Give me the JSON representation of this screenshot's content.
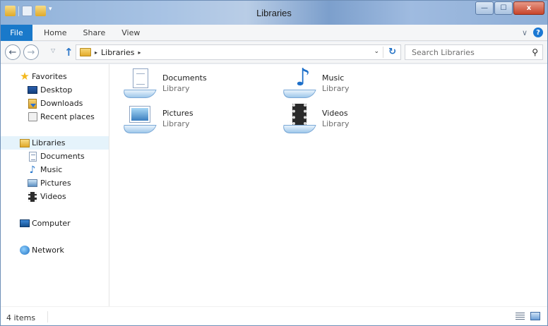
{
  "window": {
    "title": "Libraries",
    "controls": {
      "minimize": "—",
      "maximize": "☐",
      "close": "x"
    }
  },
  "ribbon": {
    "file_label": "File",
    "tabs": [
      "Home",
      "Share",
      "View"
    ],
    "expand_icon": "chevron-down-icon",
    "help_label": "?"
  },
  "nav": {
    "back_glyph": "←",
    "forward_glyph": "→",
    "recent_glyph": "▽",
    "up_glyph": "↑"
  },
  "address": {
    "arrow": "▸",
    "crumbs": [
      "Libraries"
    ],
    "dropdown_glyph": "⌄",
    "refresh_glyph": "↻"
  },
  "search": {
    "placeholder": "Search Libraries",
    "icon": "search-icon"
  },
  "sidebar": {
    "favorites": {
      "label": "Favorites",
      "items": [
        {
          "label": "Desktop",
          "icon": "desktop-icon"
        },
        {
          "label": "Downloads",
          "icon": "downloads-icon"
        },
        {
          "label": "Recent places",
          "icon": "recent-places-icon"
        }
      ]
    },
    "libraries": {
      "label": "Libraries",
      "selected": true,
      "items": [
        {
          "label": "Documents",
          "icon": "documents-icon"
        },
        {
          "label": "Music",
          "icon": "music-icon"
        },
        {
          "label": "Pictures",
          "icon": "pictures-icon"
        },
        {
          "label": "Videos",
          "icon": "videos-icon"
        }
      ]
    },
    "computer": {
      "label": "Computer",
      "icon": "computer-icon"
    },
    "network": {
      "label": "Network",
      "icon": "network-icon"
    }
  },
  "main": {
    "libraries": [
      {
        "name": "Documents",
        "type": "Library",
        "icon": "documents-library-icon"
      },
      {
        "name": "Music",
        "type": "Library",
        "icon": "music-library-icon"
      },
      {
        "name": "Pictures",
        "type": "Library",
        "icon": "pictures-library-icon"
      },
      {
        "name": "Videos",
        "type": "Library",
        "icon": "videos-library-icon"
      }
    ]
  },
  "status": {
    "item_count": "4 items"
  },
  "colors": {
    "file_tab": "#1979ca",
    "selection": "#e5f3fb",
    "accent": "#1b78d3"
  }
}
